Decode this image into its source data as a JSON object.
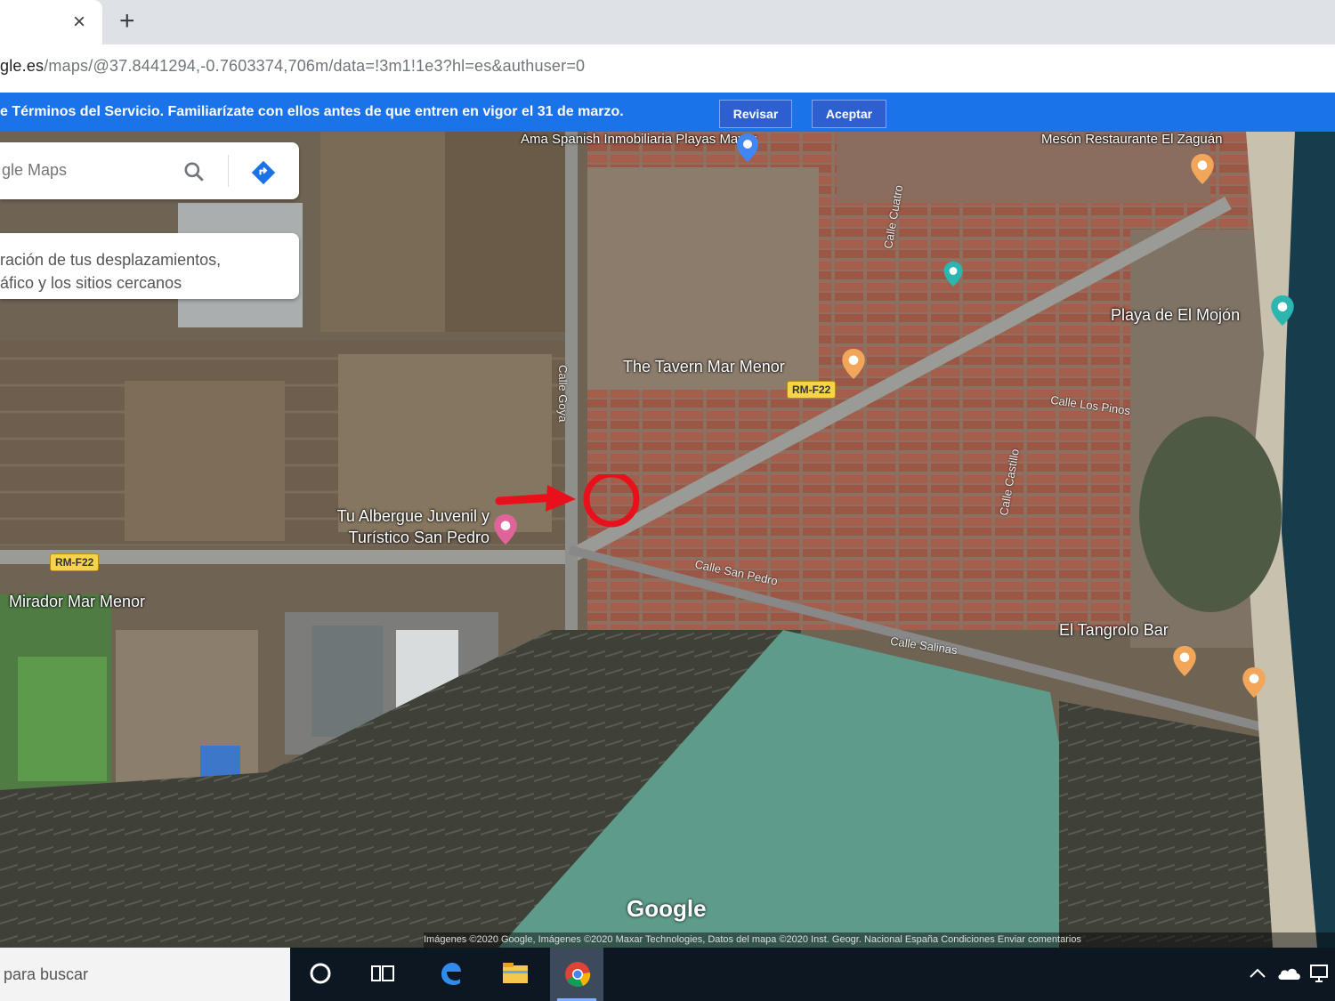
{
  "browser": {
    "tab_close_glyph": "×",
    "new_tab_glyph": "+",
    "url_host": "gle.es",
    "url_path": "/maps/@37.8441294,-0.7603374,706m/data=!3m1!1e3?hl=es&authuser=0"
  },
  "infobar": {
    "text": "e Términos del Servicio. Familiarízate con ellos antes de que entren en vigor el 31 de marzo.",
    "review_label": "Revisar",
    "accept_label": "Aceptar"
  },
  "search": {
    "placeholder": "gle Maps"
  },
  "tip_card": {
    "line1": "ración de tus desplazamientos,",
    "line2": "áfico y los sitios cercanos"
  },
  "map": {
    "places": [
      "Ama Spanish Inmobiliaria Playas Mayor",
      "Mesón Restaurante El Zaguán",
      "Playa de El Mojón",
      "The Tavern Mar Menor",
      "Tu Albergue Juvenil y Turístico San Pedro",
      "Mirador Mar Menor",
      "El Tangrolo Bar"
    ],
    "roads": [
      "Calle Goya",
      "Calle Cuatro",
      "Calle Salinas",
      "Calle San Pedro",
      "Calle Los Pinos",
      "Calle Castillo"
    ],
    "road_badges": [
      "RM-F22",
      "RM-F22"
    ],
    "google_logo": "Google",
    "attribution": "Imágenes ©2020 Google, Imágenes ©2020 Maxar Technologies, Datos del mapa ©2020 Inst. Geogr. Nacional   España   Condiciones   Enviar comentarios",
    "colors": {
      "water": "#5e9b8a",
      "sea": "#173c4c",
      "marker_orange": "#f2a65a",
      "marker_teal": "#2bb6b0",
      "marker_pink": "#e0649a",
      "annotation_red": "#e8111b"
    }
  },
  "taskbar": {
    "search_text": "para buscar",
    "icons": [
      "cortana-icon",
      "task-view-icon",
      "edge-icon",
      "file-explorer-icon",
      "chrome-icon"
    ]
  }
}
